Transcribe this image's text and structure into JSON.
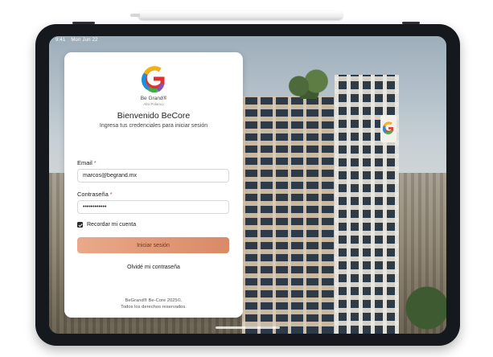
{
  "status_bar": {
    "time": "9:41",
    "date": "Mon Jun 22"
  },
  "brand": {
    "name": "Be Grand",
    "registered": "®",
    "location": "Alto Polanco",
    "logo_letter": "G"
  },
  "login": {
    "title": "Bienvenido BeCore",
    "subtitle": "Ingresa tus credenciales para iniciar sesión",
    "email_label": "Email",
    "email_value": "marcos@begrand.mx",
    "password_label": "Contraseña",
    "password_value": "••••••••••••",
    "required_mark": "*",
    "remember_label": "Recordar mi cuenta",
    "remember_checked": true,
    "submit_label": "Iniciar sesión",
    "forgot_label": "Olvidé mi contraseña"
  },
  "footer": {
    "line1": "BeGrand® Be-Core 2025©.",
    "line2": "Todos los derechos reservados."
  },
  "colors": {
    "button_start": "#eaa98a",
    "button_end": "#d98a66",
    "required": "#d64541"
  }
}
